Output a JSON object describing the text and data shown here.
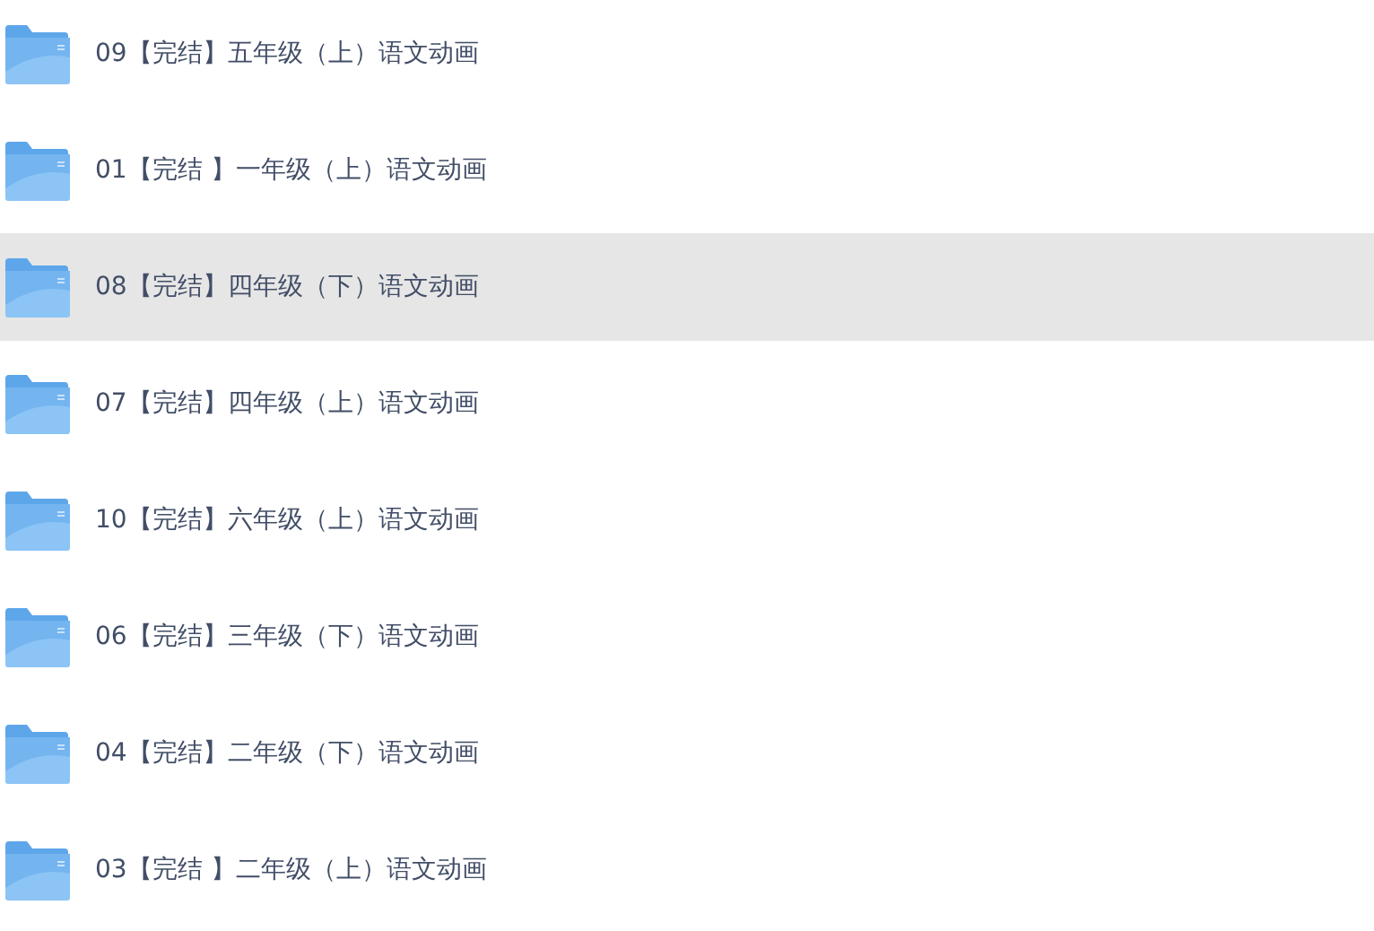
{
  "folders": [
    {
      "name": "09【完结】五年级（上）语文动画",
      "selected": false
    },
    {
      "name": "01【完结 】一年级（上）语文动画",
      "selected": false
    },
    {
      "name": "08【完结】四年级（下）语文动画",
      "selected": true
    },
    {
      "name": "07【完结】四年级（上）语文动画",
      "selected": false
    },
    {
      "name": "10【完结】六年级（上）语文动画",
      "selected": false
    },
    {
      "name": "06【完结】三年级（下）语文动画",
      "selected": false
    },
    {
      "name": "04【完结】二年级（下）语文动画",
      "selected": false
    },
    {
      "name": "03【完结 】二年级（上）语文动画",
      "selected": false
    }
  ]
}
